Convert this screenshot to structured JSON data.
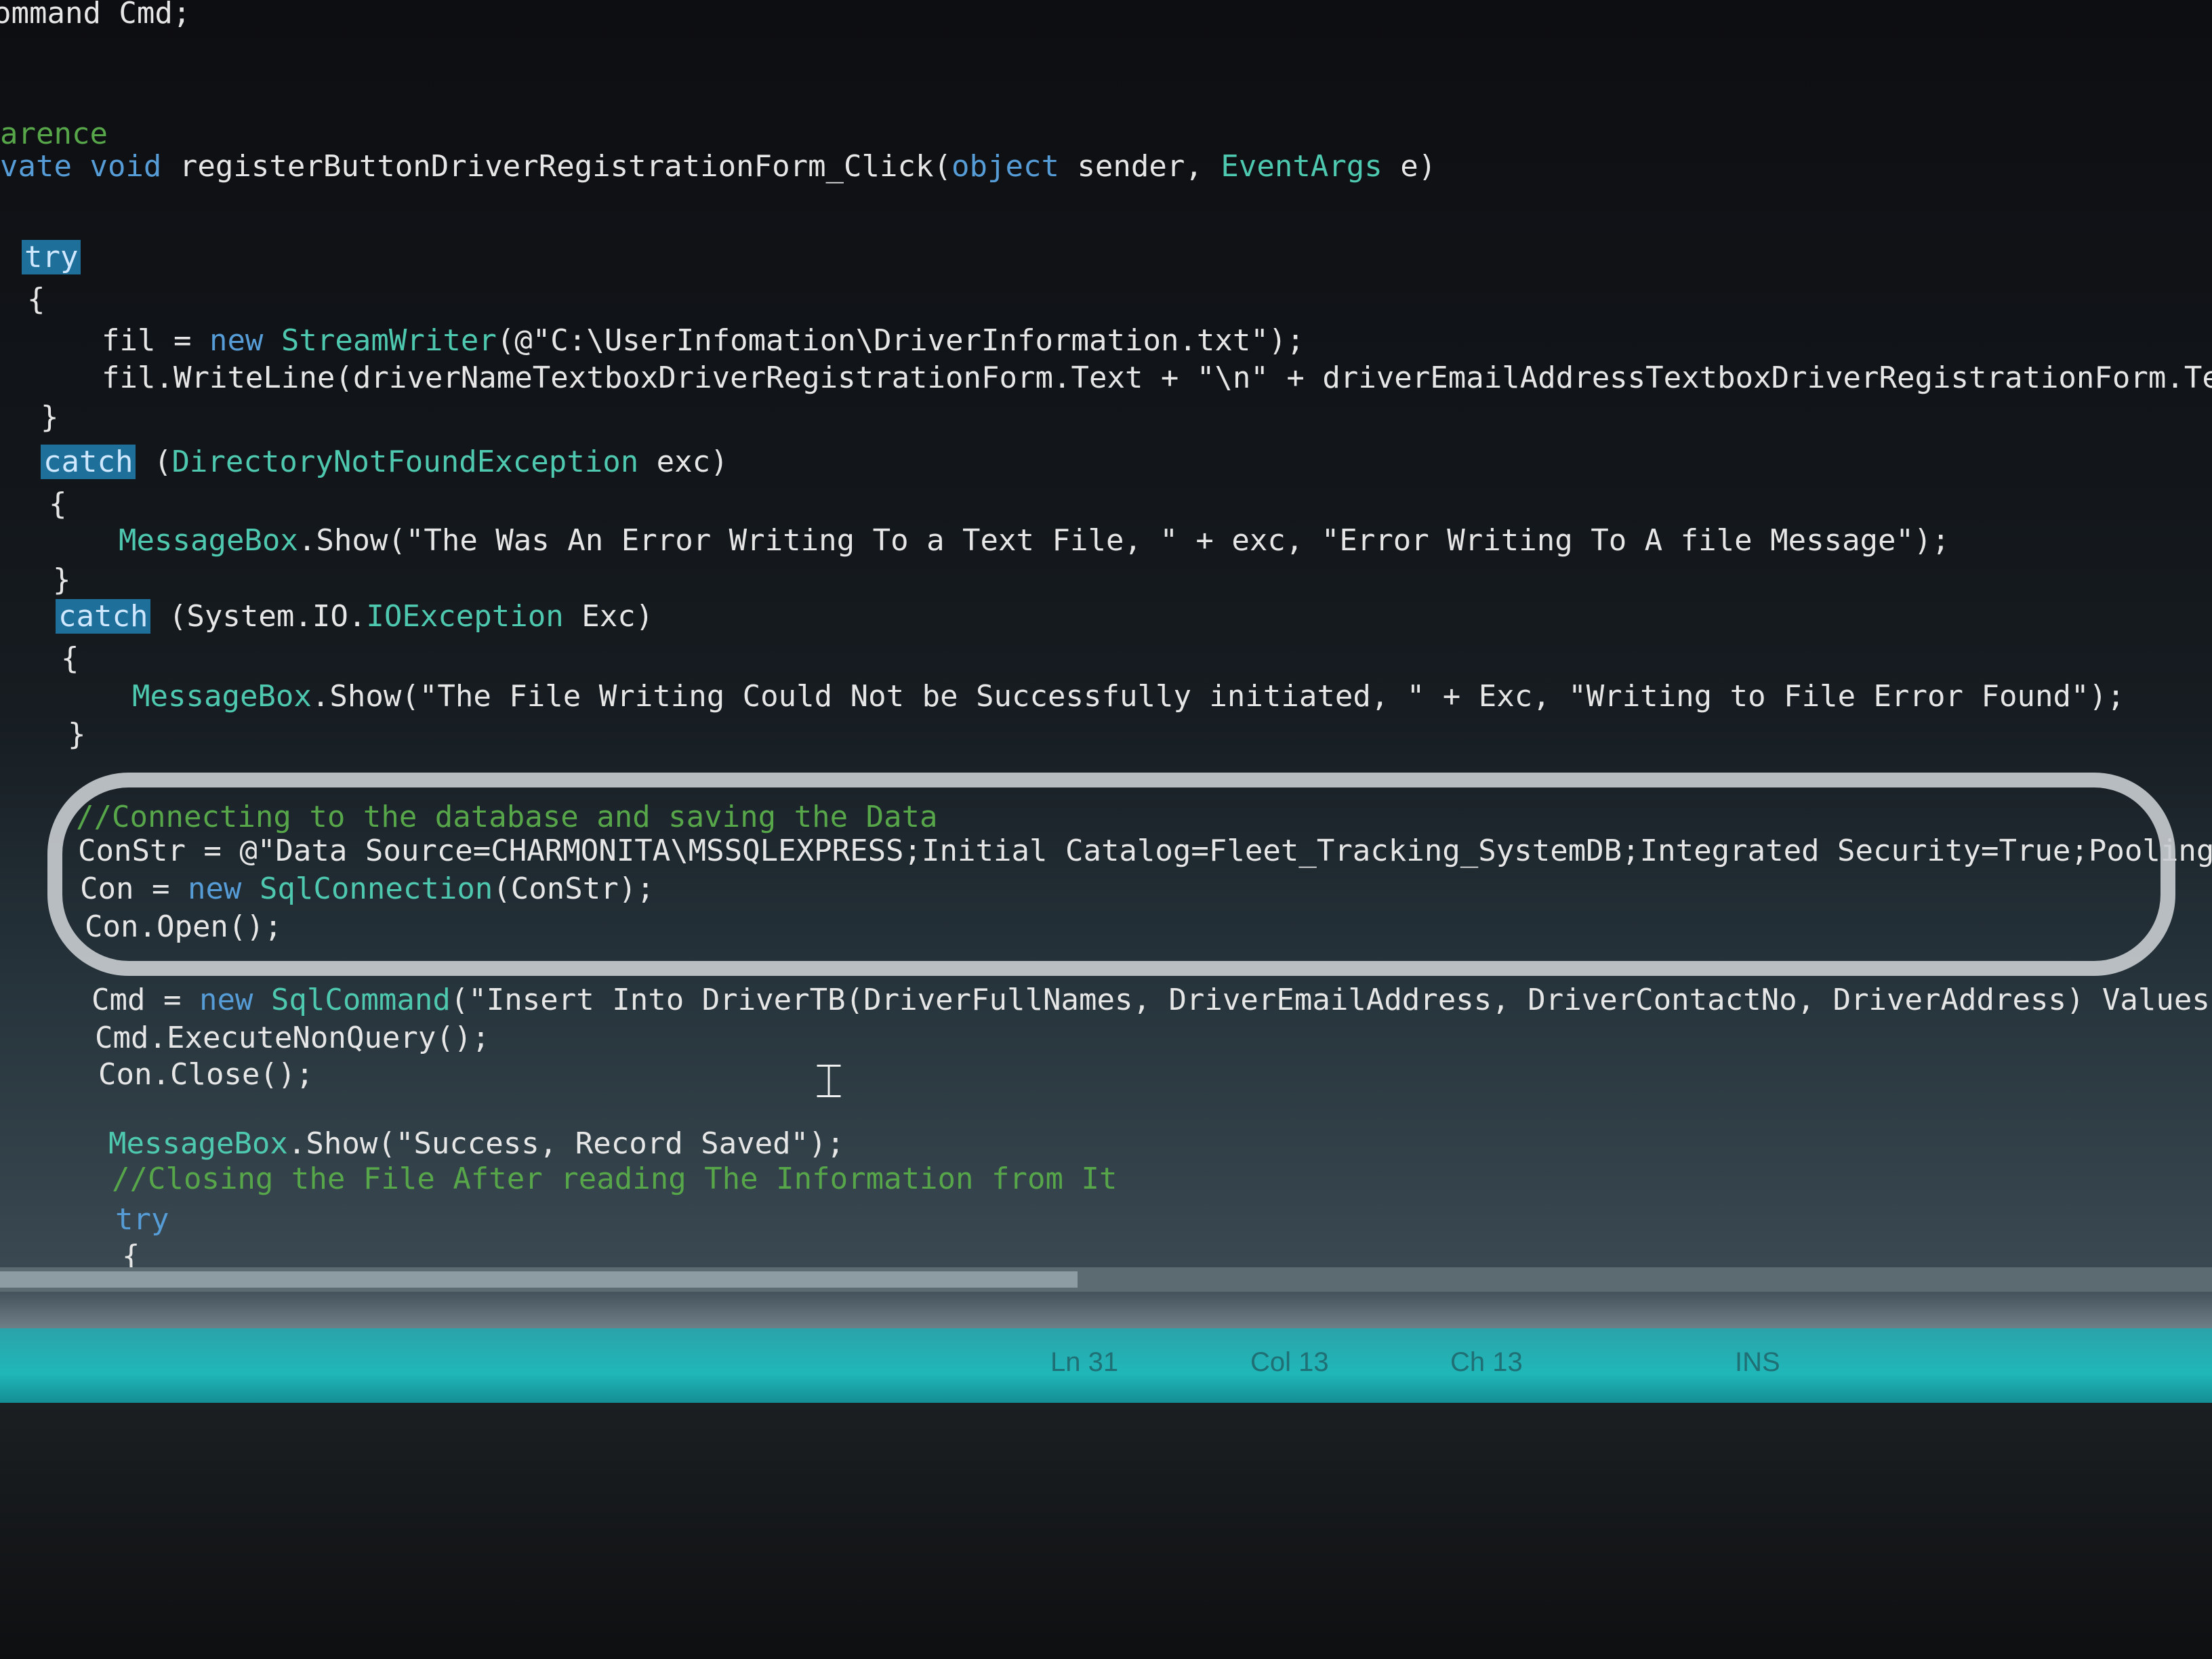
{
  "editor": {
    "lines": [
      {
        "parts": [
          {
            "t": "ommand Cmd;",
            "c": ""
          }
        ]
      },
      {
        "parts": [
          {
            "t": "arence",
            "c": "cm"
          }
        ]
      },
      {
        "parts": [
          {
            "t": "vate void ",
            "c": "kw"
          },
          {
            "t": "registerButtonDriverRegistrationForm_Click(",
            "c": ""
          },
          {
            "t": "object",
            "c": "kw"
          },
          {
            "t": " sender, ",
            "c": ""
          },
          {
            "t": "EventArgs",
            "c": "ty"
          },
          {
            "t": " e)",
            "c": ""
          }
        ]
      },
      {
        "parts": [
          {
            "t": "try",
            "c": "hl"
          }
        ]
      },
      {
        "parts": [
          {
            "t": "{",
            "c": ""
          }
        ]
      },
      {
        "parts": [
          {
            "t": "fil = ",
            "c": ""
          },
          {
            "t": "new ",
            "c": "kw"
          },
          {
            "t": "StreamWriter",
            "c": "ty"
          },
          {
            "t": "(@\"C:\\UserInfomation\\DriverInformation.txt\");",
            "c": ""
          }
        ]
      },
      {
        "parts": [
          {
            "t": "fil.WriteLine(driverNameTextboxDriverRegistrationForm.Text + \"\\n\" + driverEmailAddressTextboxDriverRegistrationForm.Text + \"",
            "c": ""
          }
        ]
      },
      {
        "parts": [
          {
            "t": "}",
            "c": ""
          }
        ]
      },
      {
        "parts": [
          {
            "t": "catch",
            "c": "hl"
          },
          {
            "t": " (",
            "c": ""
          },
          {
            "t": "DirectoryNotFoundException",
            "c": "ty"
          },
          {
            "t": " exc)",
            "c": ""
          }
        ]
      },
      {
        "parts": [
          {
            "t": "{",
            "c": ""
          }
        ]
      },
      {
        "parts": [
          {
            "t": "MessageBox",
            "c": "ty"
          },
          {
            "t": ".Show(\"The Was An Error Writing To a Text File, \" + exc, \"Error Writing To A file Message\");",
            "c": ""
          }
        ]
      },
      {
        "parts": [
          {
            "t": "}",
            "c": ""
          }
        ]
      },
      {
        "parts": [
          {
            "t": "catch",
            "c": "hl"
          },
          {
            "t": " (System.IO.",
            "c": ""
          },
          {
            "t": "IOException",
            "c": "ty"
          },
          {
            "t": " Exc)",
            "c": ""
          }
        ]
      },
      {
        "parts": [
          {
            "t": "{",
            "c": ""
          }
        ]
      },
      {
        "parts": [
          {
            "t": "MessageBox",
            "c": "ty"
          },
          {
            "t": ".Show(\"The File Writing Could Not be Successfully initiated, \" + Exc, \"Writing to File Error Found\");",
            "c": ""
          }
        ]
      },
      {
        "parts": [
          {
            "t": "}",
            "c": ""
          }
        ]
      },
      {
        "parts": [
          {
            "t": "//Connecting to the database and saving the Data",
            "c": "cm"
          }
        ]
      },
      {
        "parts": [
          {
            "t": "ConStr = @\"Data Source=CHARMONITA\\MSSQLEXPRESS;Initial Catalog=Fleet_Tracking_SystemDB;Integrated Security=True;Pooling=False\";",
            "c": ""
          }
        ]
      },
      {
        "parts": [
          {
            "t": "Con = ",
            "c": ""
          },
          {
            "t": "new ",
            "c": "kw"
          },
          {
            "t": "SqlConnection",
            "c": "ty"
          },
          {
            "t": "(ConStr);",
            "c": ""
          }
        ]
      },
      {
        "parts": [
          {
            "t": "Con.Open();",
            "c": ""
          }
        ]
      },
      {
        "parts": [
          {
            "t": "Cmd = ",
            "c": ""
          },
          {
            "t": "new ",
            "c": "kw"
          },
          {
            "t": "SqlCommand",
            "c": "ty"
          },
          {
            "t": "(\"Insert Into DriverTB(DriverFullNames, DriverEmailAddress, DriverContactNo, DriverAddress) Values('\"+ driverName",
            "c": ""
          }
        ]
      },
      {
        "parts": [
          {
            "t": "Cmd.ExecuteNonQuery();",
            "c": ""
          }
        ]
      },
      {
        "parts": [
          {
            "t": "Con.Close();",
            "c": ""
          }
        ]
      },
      {
        "parts": [
          {
            "t": "MessageBox",
            "c": "ty"
          },
          {
            "t": ".Show(\"Success, Record Saved\");",
            "c": ""
          }
        ]
      },
      {
        "parts": [
          {
            "t": "//Closing the File After reading The Information from It",
            "c": "cm"
          }
        ]
      },
      {
        "parts": [
          {
            "t": "try",
            "c": "kw"
          }
        ]
      },
      {
        "parts": [
          {
            "t": "{",
            "c": ""
          }
        ]
      }
    ]
  },
  "statusbar": {
    "line": "Ln 31",
    "col": "Col 13",
    "ch": "Ch 13",
    "mode": "INS"
  },
  "colors": {
    "keyword": "#569cd6",
    "type": "#4ec9b0",
    "comment": "#57a64a",
    "highlight": "#1e6f99",
    "statusbar": "#20b7b9"
  },
  "icons": {
    "cursor": "text-cursor-icon"
  }
}
